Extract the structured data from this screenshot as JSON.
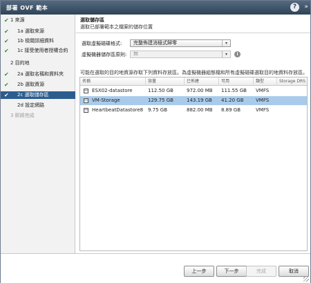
{
  "window": {
    "title": "部署 OVF 範本",
    "help_label": "?",
    "expand_label": "»"
  },
  "steps": [
    {
      "label": "1 來源",
      "state": "done",
      "level": "main",
      "check": "✔"
    },
    {
      "label": "1a 選取來源",
      "state": "done",
      "level": "sub",
      "check": "✔"
    },
    {
      "label": "1b 檢閱詳細資料",
      "state": "done",
      "level": "sub",
      "check": "✔"
    },
    {
      "label": "1c 接受使用者授權合約",
      "state": "done",
      "level": "sub",
      "check": "✔"
    },
    {
      "label": "2 目的地",
      "state": "current",
      "level": "main",
      "check": ""
    },
    {
      "label": "2a 選取名稱和資料夾",
      "state": "done",
      "level": "sub",
      "check": "✔"
    },
    {
      "label": "2b 選取資源",
      "state": "done",
      "level": "sub",
      "check": "✔"
    },
    {
      "label": "2c 選取儲存區",
      "state": "active",
      "level": "sub",
      "check": "✔"
    },
    {
      "label": "2d 設定網路",
      "state": "pending",
      "level": "sub",
      "check": ""
    },
    {
      "label": "3 即將完成",
      "state": "disabled",
      "level": "main",
      "check": ""
    }
  ],
  "main": {
    "heading": "選取儲存區",
    "subheading": "選取已部署範本之檔案的儲存位置",
    "disk_format_label": "選取虛擬磁碟格式:",
    "disk_format_value": "完整佈建消極式歸零",
    "disk_format_arrow": "▾",
    "storage_policy_label": "虛擬機器儲存區原則:",
    "storage_policy_value": "無",
    "storage_policy_arrow": "▾",
    "info_icon": "i",
    "note": "可能在選取的目的地資源存取下列資料存放區。為虛擬機器組態檔和所有虛擬磁碟選取目的地資料存放區。"
  },
  "table": {
    "columns": [
      "名稱",
      "容量",
      "已佈建",
      "可用",
      "類型",
      "Storage DRS"
    ],
    "rows": [
      {
        "name": "ESX02-datastore",
        "capacity": "112.50 GB",
        "provisioned": "972.00 MB",
        "free": "111.55 GB",
        "type": "VMFS",
        "sdrs": "",
        "selected": false
      },
      {
        "name": "VM-Storage",
        "capacity": "129.75 GB",
        "provisioned": "143.19 GB",
        "free": "41.20 GB",
        "type": "VMFS",
        "sdrs": "",
        "selected": true
      },
      {
        "name": "HeartbeatDatastore8",
        "capacity": "9.75 GB",
        "provisioned": "882.00 MB",
        "free": "8.89 GB",
        "type": "VMFS",
        "sdrs": "",
        "selected": false
      }
    ]
  },
  "footer": {
    "back": "上一步",
    "next": "下一步",
    "finish": "完成",
    "cancel": "取消"
  },
  "colors": {
    "titlebar": "#3f5469",
    "active_step": "#2c5d8f",
    "selected_row": "#a9cbeb",
    "check": "#2f8a2f"
  }
}
